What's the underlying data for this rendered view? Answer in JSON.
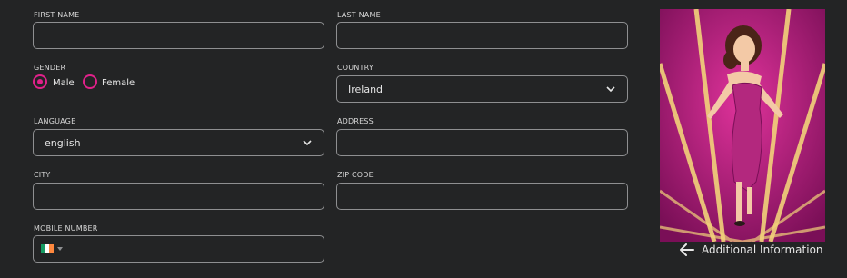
{
  "form": {
    "first_name": {
      "label": "FIRST NAME",
      "value": ""
    },
    "last_name": {
      "label": "LAST NAME",
      "value": ""
    },
    "gender": {
      "label": "GENDER",
      "options": [
        "Male",
        "Female"
      ],
      "selected": "Male"
    },
    "country": {
      "label": "COUNTRY",
      "value": "Ireland"
    },
    "language": {
      "label": "LANGUAGE",
      "value": "english"
    },
    "address": {
      "label": "ADDRESS",
      "value": ""
    },
    "city": {
      "label": "CITY",
      "value": ""
    },
    "zip": {
      "label": "ZIP CODE",
      "value": ""
    },
    "mobile": {
      "label": "MOBILE NUMBER",
      "value": "",
      "flag_colors": [
        "#169b62",
        "#ffffff",
        "#ff883e"
      ]
    }
  },
  "sidebar": {
    "back_label": "Additional Information"
  },
  "colors": {
    "accent": "#e0218a",
    "background": "#232425",
    "field_border": "#8e8f91"
  },
  "icons": {
    "select_arrow": "chevron-down-icon",
    "back": "arrow-left-icon"
  }
}
